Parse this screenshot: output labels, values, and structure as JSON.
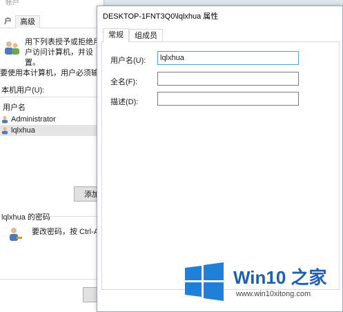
{
  "back_window": {
    "title": "帐户",
    "tabs": [
      "户",
      "高级"
    ],
    "description": "用下列表授予或拒绝用户访问计算机，并设置。",
    "checkbox_label": "要使用本计算机，用户必须输入",
    "local_users_label": "本机用户(U):",
    "list_header": "用户名",
    "users": [
      "Administrator",
      "lqlxhua"
    ],
    "add_button": "添加",
    "password_group": "lqlxhua 的密码",
    "password_desc": "要改密码，按 Ctrl-Alt-"
  },
  "dialog": {
    "title": "DESKTOP-1FNT3Q0\\lqlxhua 属性",
    "tabs": [
      "常规",
      "组成员"
    ],
    "fields": [
      {
        "label": "用户名(U):",
        "value": "lqlxhua"
      },
      {
        "label": "全名(F):",
        "value": ""
      },
      {
        "label": "描述(D):",
        "value": ""
      }
    ]
  },
  "watermark": {
    "brand": "Win10 之家",
    "url": "www.win10xitong.com"
  },
  "colors": {
    "win_blue": "#1f7fd9",
    "brand_text": "#1f5fb0"
  }
}
